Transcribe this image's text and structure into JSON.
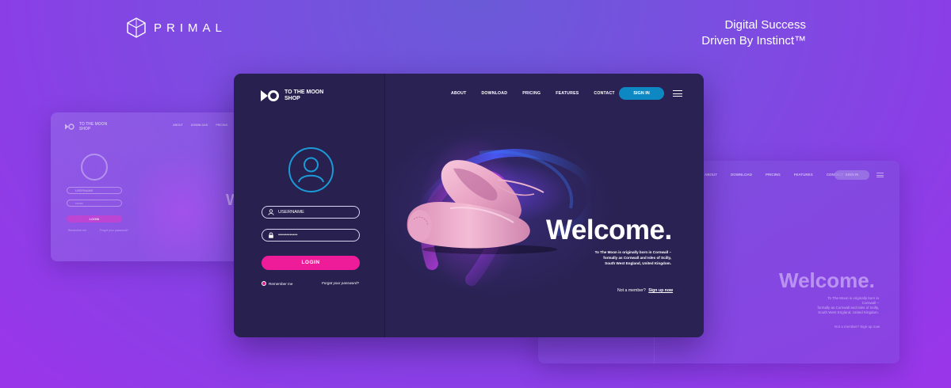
{
  "brand": {
    "name": "PRIMAL",
    "tagline_line1": "Digital Success",
    "tagline_line2": "Driven By Instinct™"
  },
  "site": {
    "brand_line1": "TO THE MOON",
    "brand_line2": "SHOP",
    "nav": [
      "ABOUT",
      "DOWNLOAD",
      "PRICING",
      "FEATURES",
      "CONTACT"
    ],
    "signin_label": "SIGN IN"
  },
  "login": {
    "username_placeholder": "USERNAME",
    "password_value": "••••••••••••",
    "login_label": "LOGIN",
    "remember_label": "Remember me",
    "forgot_label": "Forgot your password?"
  },
  "hero": {
    "welcome": "Welcome.",
    "body_line1": "To The Moon is originally born in Cornwall –",
    "body_line2": "formally as Cornwall and Isles of Scilly,",
    "body_line3": "South West England, United Kingdom.",
    "not_member": "Not a member?",
    "signup_label": "Sign up now"
  },
  "ghost_left": {
    "brand_line1": "TO THE MOON",
    "brand_line2": "SHOP",
    "nav": [
      "ABOUT",
      "DOWNLOAD",
      "PRICING",
      "FE"
    ],
    "username": "USERNAME",
    "password": "•••••••",
    "login_label": "LOGIN",
    "remember_label": "Remember me",
    "forgot_label": "Forgot your password?",
    "welcome": "W"
  },
  "ghost_right": {
    "nav": [
      "ABOUT",
      "DOWNLOAD",
      "PRICING",
      "FEATURES",
      "CONTACT"
    ],
    "signin_label": "SIGN IN",
    "welcome": "Welcome.",
    "body_line1": "To The Moon is originally born in Cornwall –",
    "body_line2": "formally as Cornwall and Isles of Scilly,",
    "body_line3": "South West England, United Kingdom.",
    "not_member": "Not a member?",
    "signup_label": "Sign up now"
  },
  "colors": {
    "card_bg": "#28204f",
    "signin": "#0e88c2",
    "login": "#ef1c9a",
    "accent_blue": "#1a9ad6"
  },
  "icons": [
    "primal-logo-icon",
    "moon-shop-logo-icon",
    "user-avatar-icon",
    "user-icon",
    "lock-icon",
    "hamburger-menu-icon"
  ]
}
